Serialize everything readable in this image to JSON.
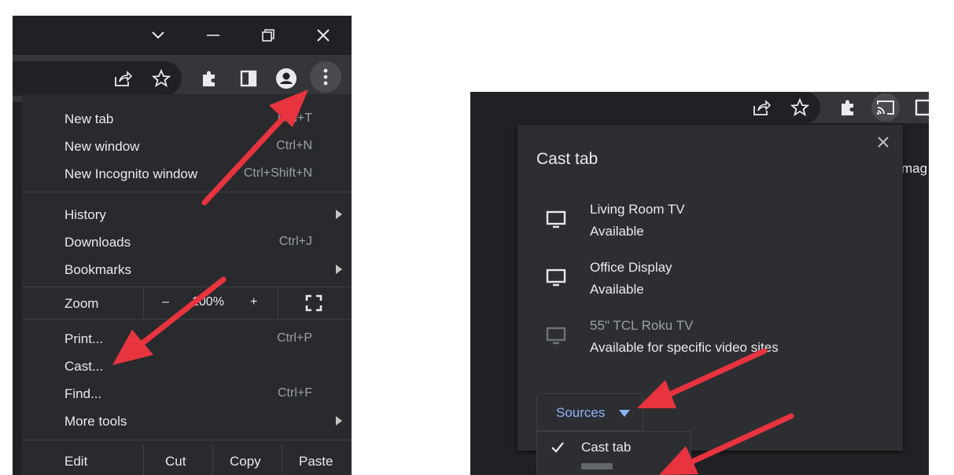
{
  "left_browser": {
    "menu": {
      "items": [
        {
          "label": "New tab",
          "shortcut": "Ctrl+T"
        },
        {
          "label": "New window",
          "shortcut": "Ctrl+N"
        },
        {
          "label": "New Incognito window",
          "shortcut": "Ctrl+Shift+N"
        },
        {
          "label": "History",
          "shortcut": ""
        },
        {
          "label": "Downloads",
          "shortcut": "Ctrl+J"
        },
        {
          "label": "Bookmarks",
          "shortcut": ""
        },
        {
          "label": "Print...",
          "shortcut": "Ctrl+P"
        },
        {
          "label": "Cast...",
          "shortcut": ""
        },
        {
          "label": "Find...",
          "shortcut": "Ctrl+F"
        },
        {
          "label": "More tools",
          "shortcut": ""
        }
      ],
      "zoom": {
        "label": "Zoom",
        "minus": "–",
        "value": "100%",
        "plus": "+"
      },
      "edit": {
        "label": "Edit",
        "cut": "Cut",
        "copy": "Copy",
        "paste": "Paste"
      }
    }
  },
  "right_browser": {
    "page_text_fragment": "mag",
    "cast_dialog": {
      "title": "Cast tab",
      "devices": [
        {
          "name": "Living Room TV",
          "status": "Available"
        },
        {
          "name": "Office Display",
          "status": "Available"
        },
        {
          "name": "55\" TCL Roku TV",
          "status": "Available for specific video sites"
        }
      ],
      "sources_label": "Sources",
      "source_options": [
        {
          "label": "Cast tab",
          "selected": true
        }
      ]
    }
  },
  "colors": {
    "arrow": "#e8343f",
    "accent_blue": "#8ab4f8",
    "menu_bg": "#292a2d"
  }
}
